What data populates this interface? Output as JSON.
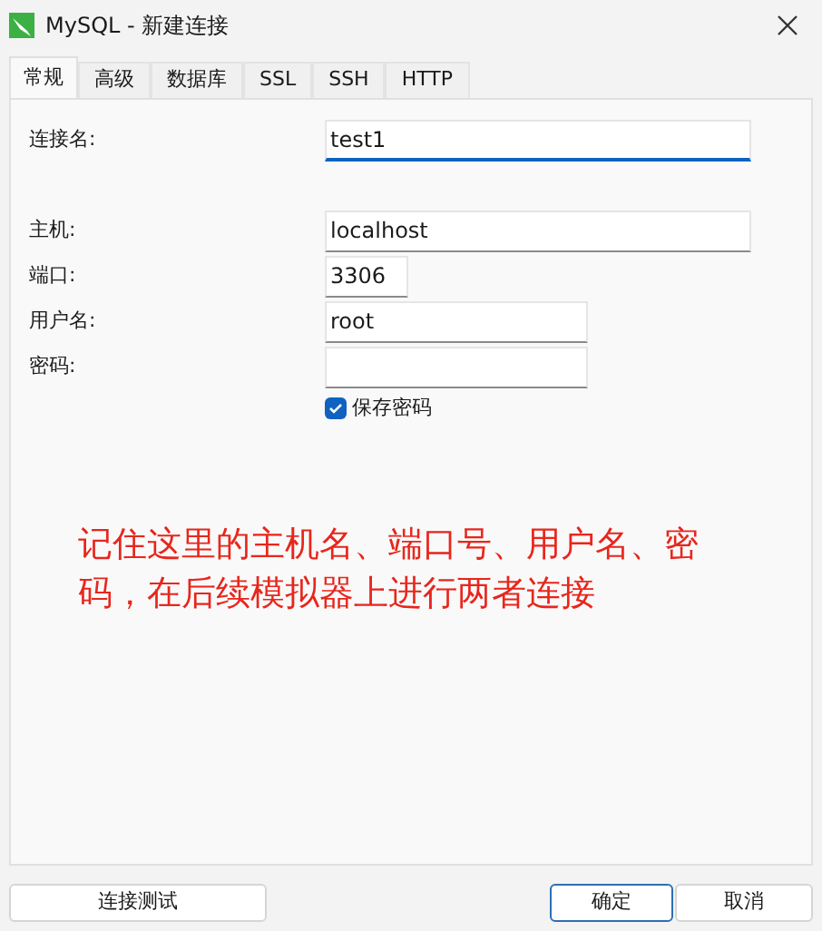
{
  "window": {
    "title": "MySQL - 新建连接"
  },
  "tabs": [
    {
      "label": "常规",
      "selected": true
    },
    {
      "label": "高级",
      "selected": false
    },
    {
      "label": "数据库",
      "selected": false
    },
    {
      "label": "SSL",
      "selected": false
    },
    {
      "label": "SSH",
      "selected": false
    },
    {
      "label": "HTTP",
      "selected": false
    }
  ],
  "fields": [
    {
      "label": "连接名:",
      "value": "test1",
      "kind": "wide",
      "focused": true
    },
    {
      "label": "主机:",
      "value": "localhost",
      "kind": "wide",
      "focused": false
    },
    {
      "label": "端口:",
      "value": "3306",
      "kind": "short",
      "focused": false
    },
    {
      "label": "用户名:",
      "value": "root",
      "kind": "medium",
      "focused": false
    },
    {
      "label": "密码:",
      "kind": "medium",
      "focused": false
    }
  ],
  "save_password": {
    "label": "保存密码",
    "checked": true
  },
  "annotation": "记住这里的主机名、端口号、用户名、密码，在后续模拟器上进行两者连接",
  "buttons": [
    {
      "label": "连接测试",
      "kind": "test"
    },
    {
      "label": "确定",
      "kind": "ok"
    },
    {
      "label": "取消",
      "kind": "cancel"
    }
  ]
}
